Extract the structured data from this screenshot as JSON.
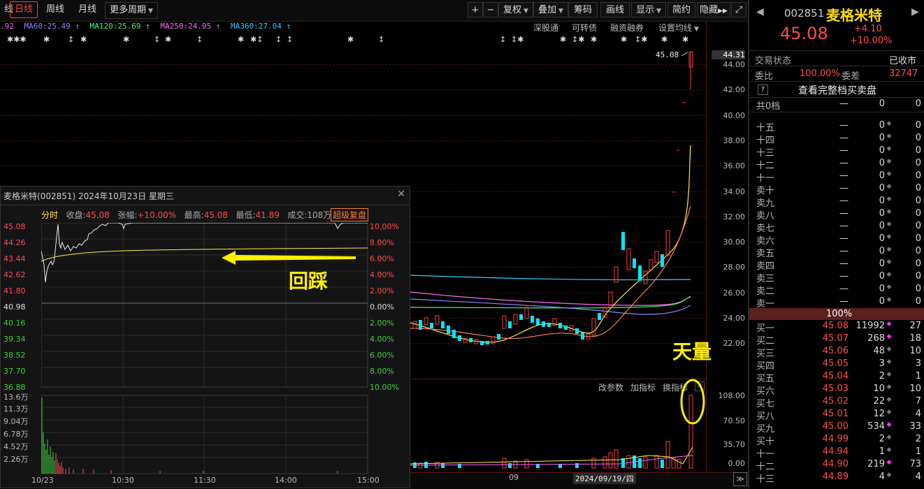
{
  "toolbar": {
    "left_cut": "线",
    "tabs": [
      "日线",
      "周线",
      "月线"
    ],
    "more": "更多周期",
    "buttons": [
      "复权",
      "叠加",
      "筹码",
      "画线",
      "显示",
      "简约",
      "隐藏"
    ]
  },
  "ma_line": {
    "items": [
      {
        "text": ".92",
        "color": "#ff5aff"
      },
      {
        "text": "MA60:25.49 ↑",
        "color": "#8a8aff"
      },
      {
        "text": "MA120:25.69 ↑",
        "color": "#33ff66"
      },
      {
        "text": "MA250:24.95 ↑",
        "color": "#ff66ff"
      },
      {
        "text": "MA360:27.04 ↑",
        "color": "#33ccff"
      }
    ],
    "options": [
      "深股通",
      "可转债",
      "融资融券",
      "设置均线"
    ]
  },
  "price_axis": [
    "44.31",
    "44.00",
    "42.00",
    "40.00",
    "38.00",
    "36.00",
    "34.00",
    "32.00",
    "30.00",
    "28.00",
    "26.00",
    "24.00",
    "22.00"
  ],
  "last_price_tag": "45.08",
  "annotation_tianliang": "天量",
  "vol_panel": {
    "buttons": [
      "改参数",
      "加指标",
      "换指标"
    ],
    "axis": [
      "108.00",
      "70.50",
      "35.70",
      "0.00"
    ]
  },
  "bottom": {
    "month": "09",
    "date": "2024/09/19/四"
  },
  "quote": {
    "code": "002851",
    "name": "麦格米特",
    "price": "45.08",
    "change": "+4.10",
    "pct": "+10.00%",
    "status_label": "交易状态",
    "status": "已收市",
    "ratio_label": "委比",
    "ratio": "100.00%",
    "diff_label": "委差",
    "diff": "32747",
    "help": "?",
    "full_book": "查看完整档买卖盘",
    "total_label": "共0档",
    "total_dash": "—",
    "total_vol": "0",
    "total_cnt": "0",
    "sell": [
      {
        "n": "十五",
        "p": "—",
        "v": "0",
        "c": "0"
      },
      {
        "n": "十四",
        "p": "—",
        "v": "0",
        "c": "0"
      },
      {
        "n": "十三",
        "p": "—",
        "v": "0",
        "c": "0"
      },
      {
        "n": "十二",
        "p": "—",
        "v": "0",
        "c": "0"
      },
      {
        "n": "十一",
        "p": "—",
        "v": "0",
        "c": "0"
      },
      {
        "n": "卖十",
        "p": "—",
        "v": "0",
        "c": "0"
      },
      {
        "n": "卖九",
        "p": "—",
        "v": "0",
        "c": "0"
      },
      {
        "n": "卖八",
        "p": "—",
        "v": "0",
        "c": "0"
      },
      {
        "n": "卖七",
        "p": "—",
        "v": "0",
        "c": "0"
      },
      {
        "n": "卖六",
        "p": "—",
        "v": "0",
        "c": "0"
      },
      {
        "n": "卖五",
        "p": "—",
        "v": "0",
        "c": "0"
      },
      {
        "n": "卖四",
        "p": "—",
        "v": "0",
        "c": "0"
      },
      {
        "n": "卖三",
        "p": "—",
        "v": "0",
        "c": "0"
      },
      {
        "n": "卖二",
        "p": "—",
        "v": "0",
        "c": "0"
      },
      {
        "n": "卖一",
        "p": "—",
        "v": "0",
        "c": "0"
      }
    ],
    "mid_bar": "100%",
    "buy": [
      {
        "n": "买一",
        "p": "45.08",
        "v": "11992",
        "c": "27"
      },
      {
        "n": "买二",
        "p": "45.07",
        "v": "268",
        "c": "18"
      },
      {
        "n": "买三",
        "p": "45.06",
        "v": "48",
        "c": "10"
      },
      {
        "n": "买四",
        "p": "45.05",
        "v": "3",
        "c": "3"
      },
      {
        "n": "买五",
        "p": "45.04",
        "v": "2",
        "c": "1"
      },
      {
        "n": "买六",
        "p": "45.03",
        "v": "10",
        "c": "10"
      },
      {
        "n": "买七",
        "p": "45.02",
        "v": "22",
        "c": "7"
      },
      {
        "n": "买八",
        "p": "45.01",
        "v": "12",
        "c": "4"
      },
      {
        "n": "买九",
        "p": "45.00",
        "v": "534",
        "c": "33"
      },
      {
        "n": "买十",
        "p": "44.99",
        "v": "2",
        "c": "2"
      },
      {
        "n": "十一",
        "p": "44.94",
        "v": "1",
        "c": "1"
      },
      {
        "n": "十二",
        "p": "44.90",
        "v": "219",
        "c": "73"
      },
      {
        "n": "十三",
        "p": "44.89",
        "v": "4",
        "c": "4"
      }
    ]
  },
  "popup": {
    "title": "麦格米特(002851) 2024年10月23日 星期三",
    "info_mode": "分时",
    "close_label": "收盘:",
    "close_val": "45.08",
    "chg_label": "张幅:",
    "chg_val": "+10.00%",
    "high_label": "最高:",
    "high_val": "45.08",
    "low_label": "最低:",
    "low_val": "41.89",
    "amt": "成交:108万",
    "super": "超级复盘",
    "left_axis": [
      "45.08",
      "44.26",
      "43.44",
      "42.62",
      "41.80",
      "40.98",
      "40.16",
      "39.34",
      "38.52",
      "37.70",
      "36.88"
    ],
    "right_axis": [
      "10.00%",
      "8.00%",
      "6.00%",
      "4.00%",
      "2.00%",
      "0.00%",
      "2.00%",
      "4.00%",
      "6.00%",
      "8.00%",
      "10.00%"
    ],
    "vol_axis": [
      "13.6万",
      "11.3万",
      "9.04万",
      "6.78万",
      "4.52万",
      "2.26万"
    ],
    "times": [
      "10/23",
      "10:30",
      "11:30",
      "14:00",
      "15:00"
    ],
    "annotation": "回踩"
  }
}
